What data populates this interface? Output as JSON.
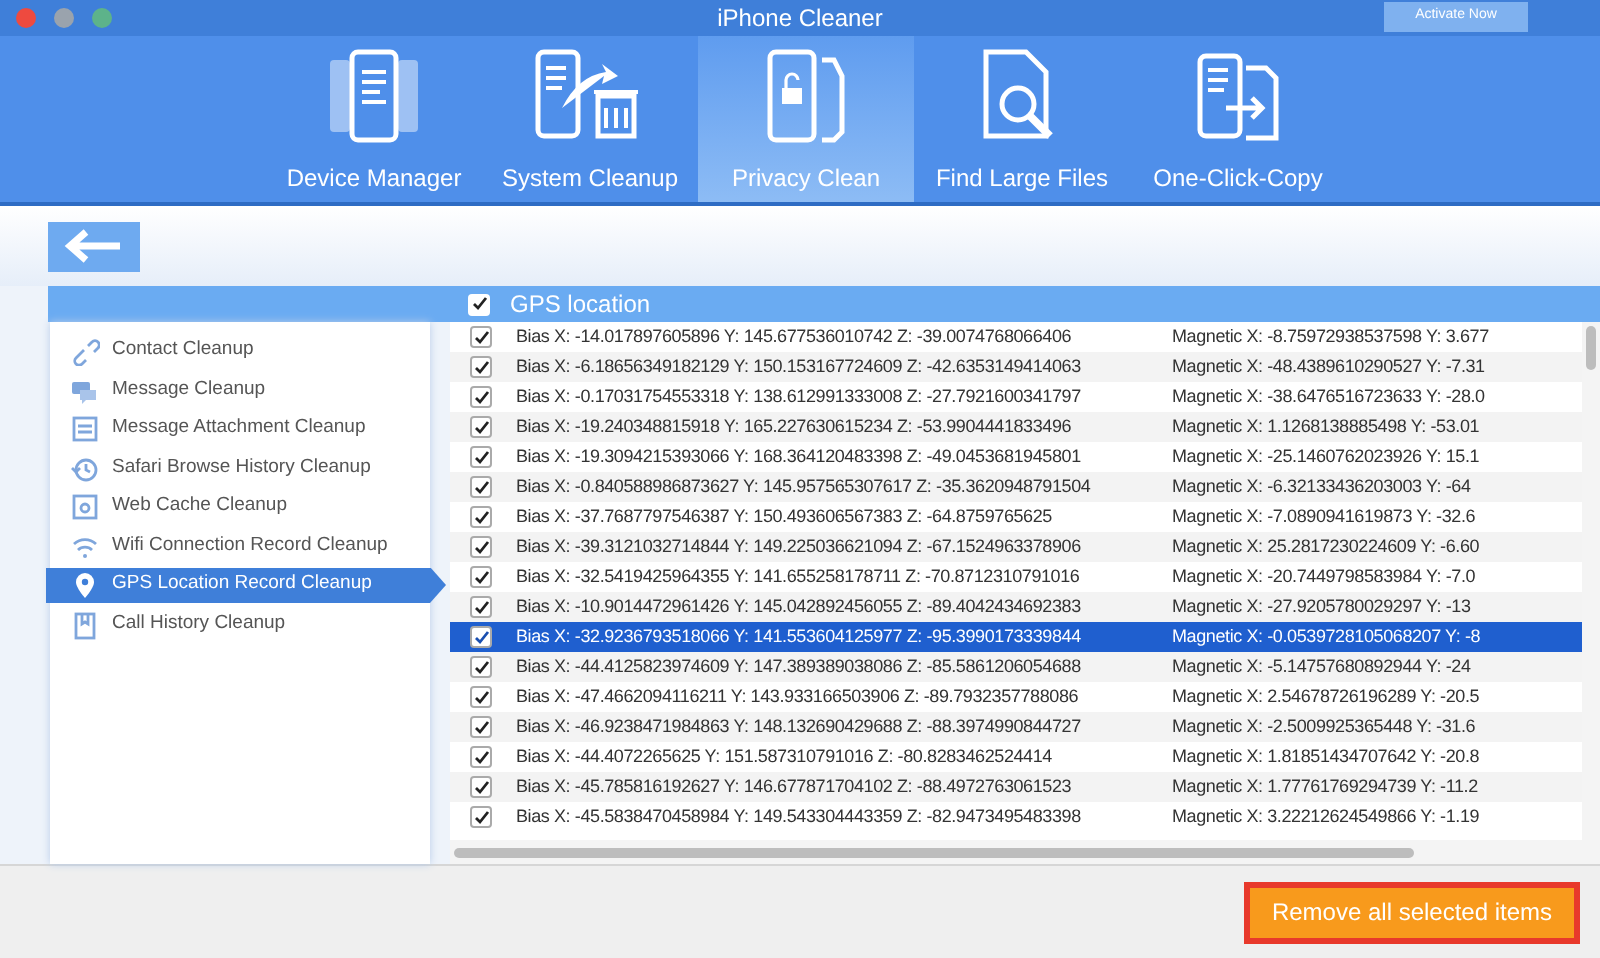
{
  "window": {
    "title": "iPhone Cleaner",
    "activate_button": "Activate Now"
  },
  "tabs": [
    {
      "label": "Device Manager",
      "selected": false,
      "kind": "device"
    },
    {
      "label": "System Cleanup",
      "selected": false,
      "kind": "system"
    },
    {
      "label": "Privacy Clean",
      "selected": true,
      "kind": "privacy"
    },
    {
      "label": "Find Large Files",
      "selected": false,
      "kind": "find"
    },
    {
      "label": "One-Click-Copy",
      "selected": false,
      "kind": "copy"
    }
  ],
  "sidebar": {
    "items": [
      {
        "label": "Contact Cleanup",
        "kind": "link",
        "selected": false
      },
      {
        "label": "Message Cleanup",
        "kind": "message",
        "selected": false
      },
      {
        "label": "Message Attachment Cleanup",
        "kind": "attachment",
        "selected": false
      },
      {
        "label": "Safari Browse History Cleanup",
        "kind": "history",
        "selected": false
      },
      {
        "label": "Web Cache Cleanup",
        "kind": "cache",
        "selected": false
      },
      {
        "label": "Wifi Connection Record Cleanup",
        "kind": "wifi",
        "selected": false
      },
      {
        "label": "GPS Location Record Cleanup",
        "kind": "pin",
        "selected": true
      },
      {
        "label": "Call History Cleanup",
        "kind": "call",
        "selected": false
      }
    ]
  },
  "table": {
    "header": {
      "label": "GPS location",
      "checked": true
    },
    "rows": [
      {
        "checked": true,
        "selected": false,
        "bias": "Bias X: -14.017897605896  Y: 145.677536010742  Z: -39.0074768066406",
        "magnetic": "Magnetic X: -8.75972938537598  Y: 3.677"
      },
      {
        "checked": true,
        "selected": false,
        "bias": "Bias X: -6.18656349182129  Y: 150.153167724609  Z: -42.6353149414063",
        "magnetic": "Magnetic X: -48.4389610290527  Y: -7.31"
      },
      {
        "checked": true,
        "selected": false,
        "bias": "Bias X: -0.17031754553318  Y: 138.612991333008  Z: -27.7921600341797",
        "magnetic": "Magnetic X: -38.6476516723633  Y: -28.0"
      },
      {
        "checked": true,
        "selected": false,
        "bias": "Bias X: -19.240348815918  Y: 165.227630615234  Z: -53.9904441833496",
        "magnetic": "Magnetic X: 1.1268138885498  Y: -53.01"
      },
      {
        "checked": true,
        "selected": false,
        "bias": "Bias X: -19.3094215393066  Y: 168.364120483398  Z: -49.0453681945801",
        "magnetic": "Magnetic X: -25.1460762023926  Y: 15.1"
      },
      {
        "checked": true,
        "selected": false,
        "bias": "Bias X: -0.840588986873627  Y: 145.957565307617  Z: -35.3620948791504",
        "magnetic": "Magnetic X: -6.32133436203003  Y: -64"
      },
      {
        "checked": true,
        "selected": false,
        "bias": "Bias X: -37.7687797546387  Y: 150.493606567383  Z: -64.8759765625",
        "magnetic": "Magnetic X: -7.0890941619873  Y: -32.6"
      },
      {
        "checked": true,
        "selected": false,
        "bias": "Bias X: -39.3121032714844  Y: 149.225036621094  Z: -67.1524963378906",
        "magnetic": "Magnetic X: 25.2817230224609  Y: -6.60"
      },
      {
        "checked": true,
        "selected": false,
        "bias": "Bias X: -32.5419425964355  Y: 141.655258178711  Z: -70.8712310791016",
        "magnetic": "Magnetic X: -20.7449798583984  Y: -7.0"
      },
      {
        "checked": true,
        "selected": false,
        "bias": "Bias X: -10.9014472961426  Y: 145.042892456055  Z: -89.4042434692383",
        "magnetic": "Magnetic X: -27.9205780029297  Y: -13"
      },
      {
        "checked": true,
        "selected": true,
        "bias": "Bias X: -32.9236793518066  Y: 141.553604125977  Z: -95.3990173339844",
        "magnetic": "Magnetic X: -0.0539728105068207  Y: -8"
      },
      {
        "checked": true,
        "selected": false,
        "bias": "Bias X: -44.4125823974609  Y: 147.389389038086  Z: -85.5861206054688",
        "magnetic": "Magnetic X: -5.14757680892944  Y: -24"
      },
      {
        "checked": true,
        "selected": false,
        "bias": "Bias X: -47.4662094116211  Y: 143.933166503906  Z: -89.7932357788086",
        "magnetic": "Magnetic X: 2.54678726196289  Y: -20.5"
      },
      {
        "checked": true,
        "selected": false,
        "bias": "Bias X: -46.9238471984863  Y: 148.132690429688  Z: -88.3974990844727",
        "magnetic": "Magnetic X: -2.5009925365448  Y: -31.6"
      },
      {
        "checked": true,
        "selected": false,
        "bias": "Bias X: -44.4072265625  Y: 151.587310791016  Z: -80.8283462524414",
        "magnetic": "Magnetic X: 1.81851434707642  Y: -20.8"
      },
      {
        "checked": true,
        "selected": false,
        "bias": "Bias X: -45.785816192627  Y: 146.677871704102  Z: -88.4972763061523",
        "magnetic": "Magnetic X: 1.77761769294739  Y: -11.2"
      },
      {
        "checked": true,
        "selected": false,
        "bias": "Bias X: -45.5838470458984  Y: 149.543304443359  Z: -82.9473495483398",
        "magnetic": "Magnetic X: 3.22212624549866  Y: -1.19"
      }
    ]
  },
  "action_button": "Remove all selected items"
}
